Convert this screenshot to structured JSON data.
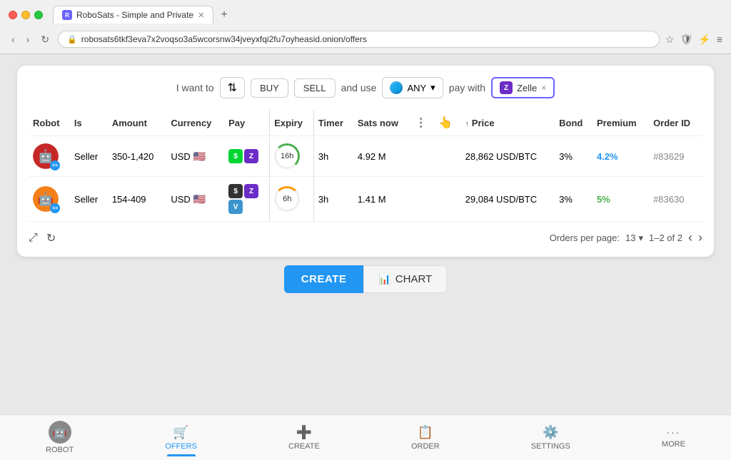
{
  "browser": {
    "tab_title": "RoboSats - Simple and Private",
    "url": "robosats6tkf3eva7x2voqso3a5wcorsnw34jveyxfqi2fu7oyheasid.onion/offers",
    "new_tab_label": "+"
  },
  "filter": {
    "i_want_to_label": "I want to",
    "toggle_icon": "⇅",
    "buy_label": "BUY",
    "sell_label": "SELL",
    "and_use_label": "and use",
    "currency_label": "ANY",
    "pay_with_label": "pay with",
    "payment_method": "Zelle",
    "payment_method_close": "×"
  },
  "table": {
    "columns": [
      "Robot",
      "Is",
      "Amount",
      "Currency",
      "Pay",
      "",
      "Expiry",
      "",
      "Timer",
      "Sats now",
      "",
      "",
      "Price",
      "Bond",
      "Premium",
      "Order ID"
    ],
    "rows": [
      {
        "robot_color": "#c62828",
        "is": "Seller",
        "amount": "350-1,420",
        "currency": "USD",
        "expiry": "16h",
        "timer": "3h",
        "sats_now": "4.92 M",
        "price": "28,862 USD/BTC",
        "bond": "3%",
        "premium": "4.2%",
        "order_id": "#83629",
        "premium_color": "#2196f3"
      },
      {
        "robot_color": "#f57f17",
        "is": "Seller",
        "amount": "154-409",
        "currency": "USD",
        "expiry": "6h",
        "timer": "3h",
        "sats_now": "1.41 M",
        "price": "29,084 USD/BTC",
        "bond": "3%",
        "premium": "5%",
        "order_id": "#83630",
        "premium_color": "#4caf50"
      }
    ]
  },
  "pagination": {
    "orders_per_page_label": "Orders per page:",
    "per_page_value": "13",
    "page_info": "1–2 of 2"
  },
  "actions": {
    "create_label": "CREATE",
    "chart_label": "CHART"
  },
  "bottom_nav": {
    "items": [
      {
        "icon": "🤖",
        "label": "ROBOT",
        "active": false
      },
      {
        "icon": "🛒",
        "label": "OFFERS",
        "active": true
      },
      {
        "icon": "➕",
        "label": "CREATE",
        "active": false
      },
      {
        "icon": "📋",
        "label": "ORDER",
        "active": false
      },
      {
        "icon": "⚙️",
        "label": "SETTINGS",
        "active": false
      },
      {
        "icon": "···",
        "label": "MORE",
        "active": false
      }
    ]
  }
}
